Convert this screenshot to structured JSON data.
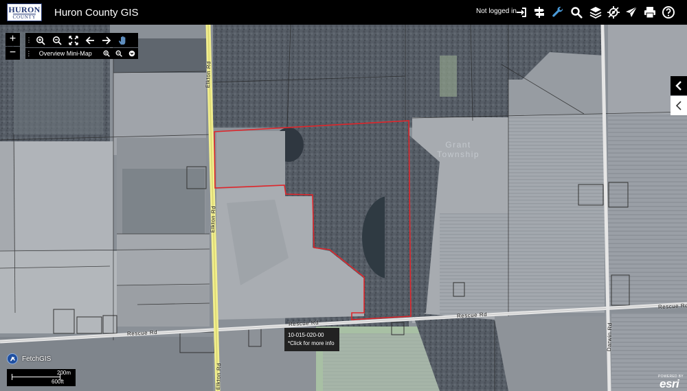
{
  "header": {
    "logo_line1": "HURON",
    "logo_line2": "COUNTY",
    "title": "Huron County GIS",
    "login_status": "Not logged in",
    "icons": [
      "login-icon",
      "directions-icon",
      "tools-wrench-icon",
      "search-icon",
      "layers-icon",
      "location-icon",
      "share-icon",
      "print-icon",
      "help-icon"
    ]
  },
  "map": {
    "roads": {
      "elkton_upper": "Elkton Rd",
      "elkton_mid": "Elkton Rd",
      "elkton_lower": "Elkton Rd",
      "rescue_left": "Rescue Rd",
      "rescue_center": "Rescue Rd",
      "rescue_mid": "Rescue Rd",
      "rescue_right": "Rescue Rd",
      "darwin": "Darwin Rd"
    },
    "township_line1": "Grant",
    "township_line2": "Township",
    "colors": {
      "parcel_outline": "#e0252a",
      "highlight_road": "#f2ef8e",
      "road": "#e8e8e8"
    }
  },
  "controls": {
    "zoom_in": "+",
    "zoom_out": "−",
    "toolbar_grip": "⋮",
    "toolbar_icons": [
      "zoom-in-icon",
      "zoom-out-icon",
      "full-extent-icon",
      "previous-extent-icon",
      "next-extent-icon",
      "pan-hand-icon"
    ],
    "minimap_label": "Overview Mini-Map",
    "minimap_icons": [
      "minimap-zoom-in-icon",
      "minimap-zoom-out-icon",
      "minimap-collapse-icon"
    ]
  },
  "popup": {
    "parcel_id": "10-015-020-00",
    "hint": "*Click for more info"
  },
  "footer": {
    "fetch_label": "FetchGIS",
    "scale_metric": "200m",
    "scale_imperial": "600ft",
    "powered_by": "POWERED BY",
    "esri": "esri"
  }
}
